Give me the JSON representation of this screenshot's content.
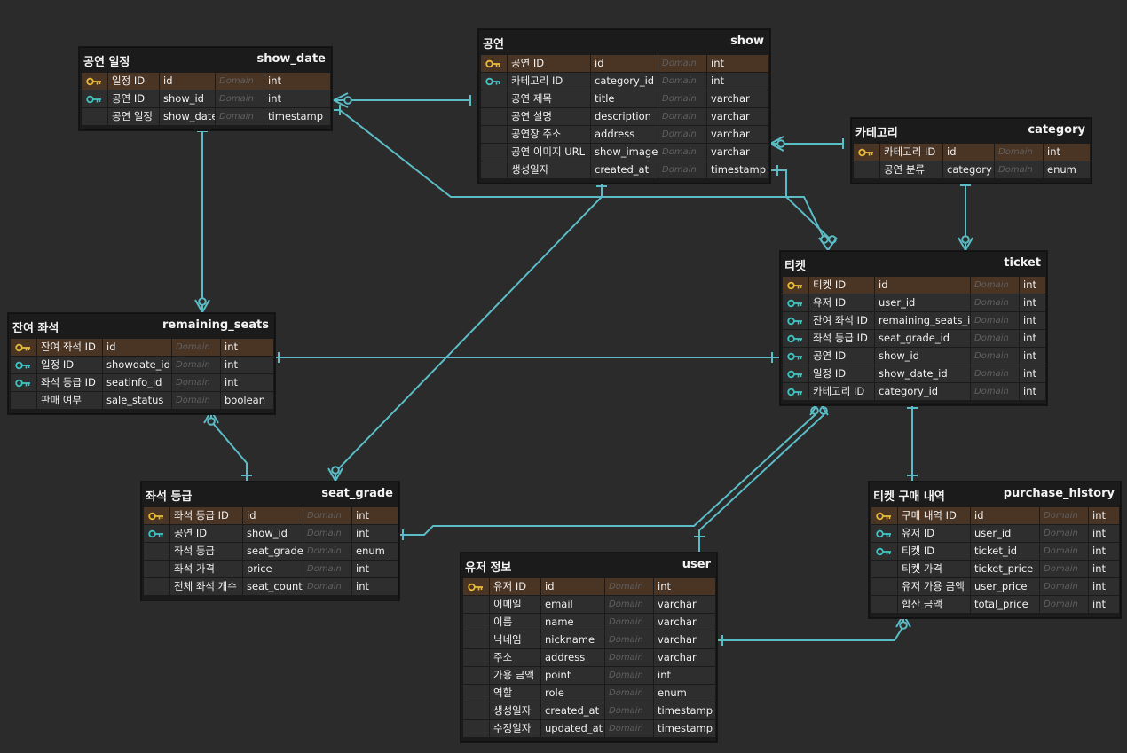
{
  "colors": {
    "background": "#2b2b2b",
    "entity_bg": "#1b1b1b",
    "pk_row": "#4a3424",
    "row": "#2e2e2e",
    "line": "#5bbcc6",
    "pk_icon": "#e6b93a",
    "fk_icon": "#3fc4c2"
  },
  "domain_placeholder": "Domain",
  "entities": {
    "show_date": {
      "logical": "공연 일정",
      "physical": "show_date",
      "rows": [
        {
          "key": "pk-fk",
          "logical": "일정 ID",
          "physical": "id",
          "type": "int"
        },
        {
          "key": "fk",
          "logical": "공연 ID",
          "physical": "show_id",
          "type": "int"
        },
        {
          "key": "",
          "logical": "공연 일정",
          "physical": "show_date",
          "type": "timestamp"
        }
      ]
    },
    "show": {
      "logical": "공연",
      "physical": "show",
      "rows": [
        {
          "key": "pk",
          "logical": "공연 ID",
          "physical": "id",
          "type": "int"
        },
        {
          "key": "fk",
          "logical": "카테고리 ID",
          "physical": "category_id",
          "type": "int"
        },
        {
          "key": "",
          "logical": "공연 제목",
          "physical": "title",
          "type": "varchar"
        },
        {
          "key": "",
          "logical": "공연 설명",
          "physical": "description",
          "type": "varchar"
        },
        {
          "key": "",
          "logical": "공연장 주소",
          "physical": "address",
          "type": "varchar"
        },
        {
          "key": "",
          "logical": "공연 이미지 URL",
          "physical": "show_image",
          "type": "varchar"
        },
        {
          "key": "",
          "logical": "생성일자",
          "physical": "created_at",
          "type": "timestamp"
        }
      ]
    },
    "category": {
      "logical": "카테고리",
      "physical": "category",
      "rows": [
        {
          "key": "pk",
          "logical": "카테고리 ID",
          "physical": "id",
          "type": "int"
        },
        {
          "key": "",
          "logical": "공연 분류",
          "physical": "category",
          "type": "enum"
        }
      ]
    },
    "ticket": {
      "logical": "티켓",
      "physical": "ticket",
      "rows": [
        {
          "key": "pk",
          "logical": "티켓 ID",
          "physical": "id",
          "type": "int"
        },
        {
          "key": "fk",
          "logical": "유저 ID",
          "physical": "user_id",
          "type": "int"
        },
        {
          "key": "fk",
          "logical": "잔여 좌석 ID",
          "physical": "remaining_seats_id",
          "type": "int"
        },
        {
          "key": "fk",
          "logical": "좌석 등급 ID",
          "physical": "seat_grade_id",
          "type": "int"
        },
        {
          "key": "fk",
          "logical": "공연 ID",
          "physical": "show_id",
          "type": "int"
        },
        {
          "key": "fk",
          "logical": "일정 ID",
          "physical": "show_date_id",
          "type": "int"
        },
        {
          "key": "fk",
          "logical": "카테고리 ID",
          "physical": "category_id",
          "type": "int"
        }
      ]
    },
    "remaining_seats": {
      "logical": "잔여 좌석",
      "physical": "remaining_seats",
      "rows": [
        {
          "key": "pk",
          "logical": "잔여 좌석 ID",
          "physical": "id",
          "type": "int"
        },
        {
          "key": "fk",
          "logical": "일정 ID",
          "physical": "showdate_id",
          "type": "int"
        },
        {
          "key": "fk",
          "logical": "좌석 등급 ID",
          "physical": "seatinfo_id",
          "type": "int"
        },
        {
          "key": "",
          "logical": "판매 여부",
          "physical": "sale_status",
          "type": "boolean"
        }
      ]
    },
    "seat_grade": {
      "logical": "좌석 등급",
      "physical": "seat_grade",
      "rows": [
        {
          "key": "pk",
          "logical": "좌석 등급 ID",
          "physical": "id",
          "type": "int"
        },
        {
          "key": "fk",
          "logical": "공연 ID",
          "physical": "show_id",
          "type": "int"
        },
        {
          "key": "",
          "logical": "좌석 등급",
          "physical": "seat_grade",
          "type": "enum"
        },
        {
          "key": "",
          "logical": "좌석 가격",
          "physical": "price",
          "type": "int"
        },
        {
          "key": "",
          "logical": "전체 좌석 개수",
          "physical": "seat_count",
          "type": "int"
        }
      ]
    },
    "user": {
      "logical": "유저 정보",
      "physical": "user",
      "rows": [
        {
          "key": "pk",
          "logical": "유저 ID",
          "physical": "id",
          "type": "int"
        },
        {
          "key": "",
          "logical": "이메일",
          "physical": "email",
          "type": "varchar"
        },
        {
          "key": "",
          "logical": "이름",
          "physical": "name",
          "type": "varchar"
        },
        {
          "key": "",
          "logical": "닉네임",
          "physical": "nickname",
          "type": "varchar"
        },
        {
          "key": "",
          "logical": "주소",
          "physical": "address",
          "type": "varchar"
        },
        {
          "key": "",
          "logical": "가용 금액",
          "physical": "point",
          "type": "int"
        },
        {
          "key": "",
          "logical": "역할",
          "physical": "role",
          "type": "enum"
        },
        {
          "key": "",
          "logical": "생성일자",
          "physical": "created_at",
          "type": "timestamp"
        },
        {
          "key": "",
          "logical": "수정일자",
          "physical": "updated_at",
          "type": "timestamp"
        }
      ]
    },
    "purchase_history": {
      "logical": "티켓 구매 내역",
      "physical": "purchase_history",
      "rows": [
        {
          "key": "pk",
          "logical": "구매 내역 ID",
          "physical": "id",
          "type": "int"
        },
        {
          "key": "fk",
          "logical": "유저 ID",
          "physical": "user_id",
          "type": "int"
        },
        {
          "key": "fk",
          "logical": "티켓 ID",
          "physical": "ticket_id",
          "type": "int"
        },
        {
          "key": "",
          "logical": "티켓 가격",
          "physical": "ticket_price",
          "type": "int"
        },
        {
          "key": "",
          "logical": "유저 가용 금액",
          "physical": "user_price",
          "type": "int"
        },
        {
          "key": "",
          "logical": "합산 금액",
          "physical": "total_price",
          "type": "int"
        }
      ]
    }
  }
}
